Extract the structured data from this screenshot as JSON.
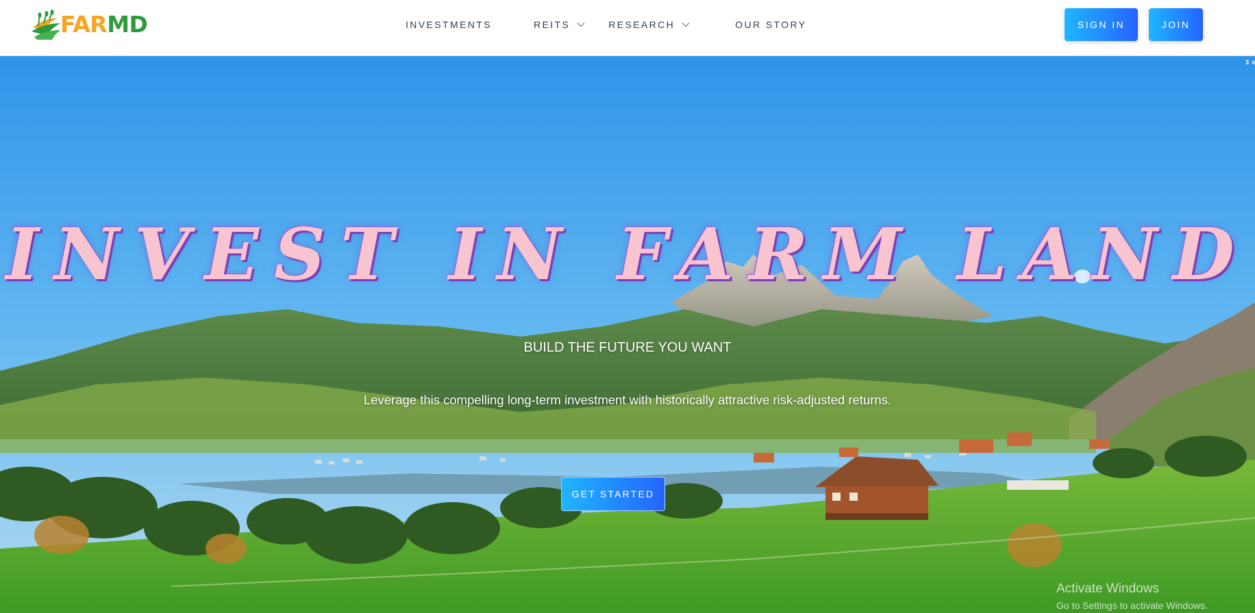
{
  "brand": {
    "logo_text_1": "FAR",
    "logo_text_2": "MD",
    "colors": {
      "gold": "#f4a623",
      "green": "#2e9a3e",
      "button_from": "#1fb6ff",
      "button_to": "#2563ff"
    }
  },
  "nav": {
    "items": [
      {
        "label": "INVESTMENTS",
        "has_dropdown": false
      },
      {
        "label": "REITS",
        "has_dropdown": true
      },
      {
        "label": "RESEARCH",
        "has_dropdown": true
      },
      {
        "label": "OUR STORY",
        "has_dropdown": false
      }
    ]
  },
  "auth": {
    "sign_in_label": "SIGN IN",
    "join_label": "JOIN"
  },
  "hero": {
    "slide_counter": "3 o",
    "title": "INVEST IN FARM LAND",
    "subtitle": "BUILD THE FUTURE YOU WANT",
    "description": "Leverage this compelling long-term investment with historically attractive risk-adjusted returns.",
    "cta_label": "GET STARTED"
  },
  "watermark": {
    "title": "Activate Windows",
    "subtitle": "Go to Settings to activate Windows."
  }
}
